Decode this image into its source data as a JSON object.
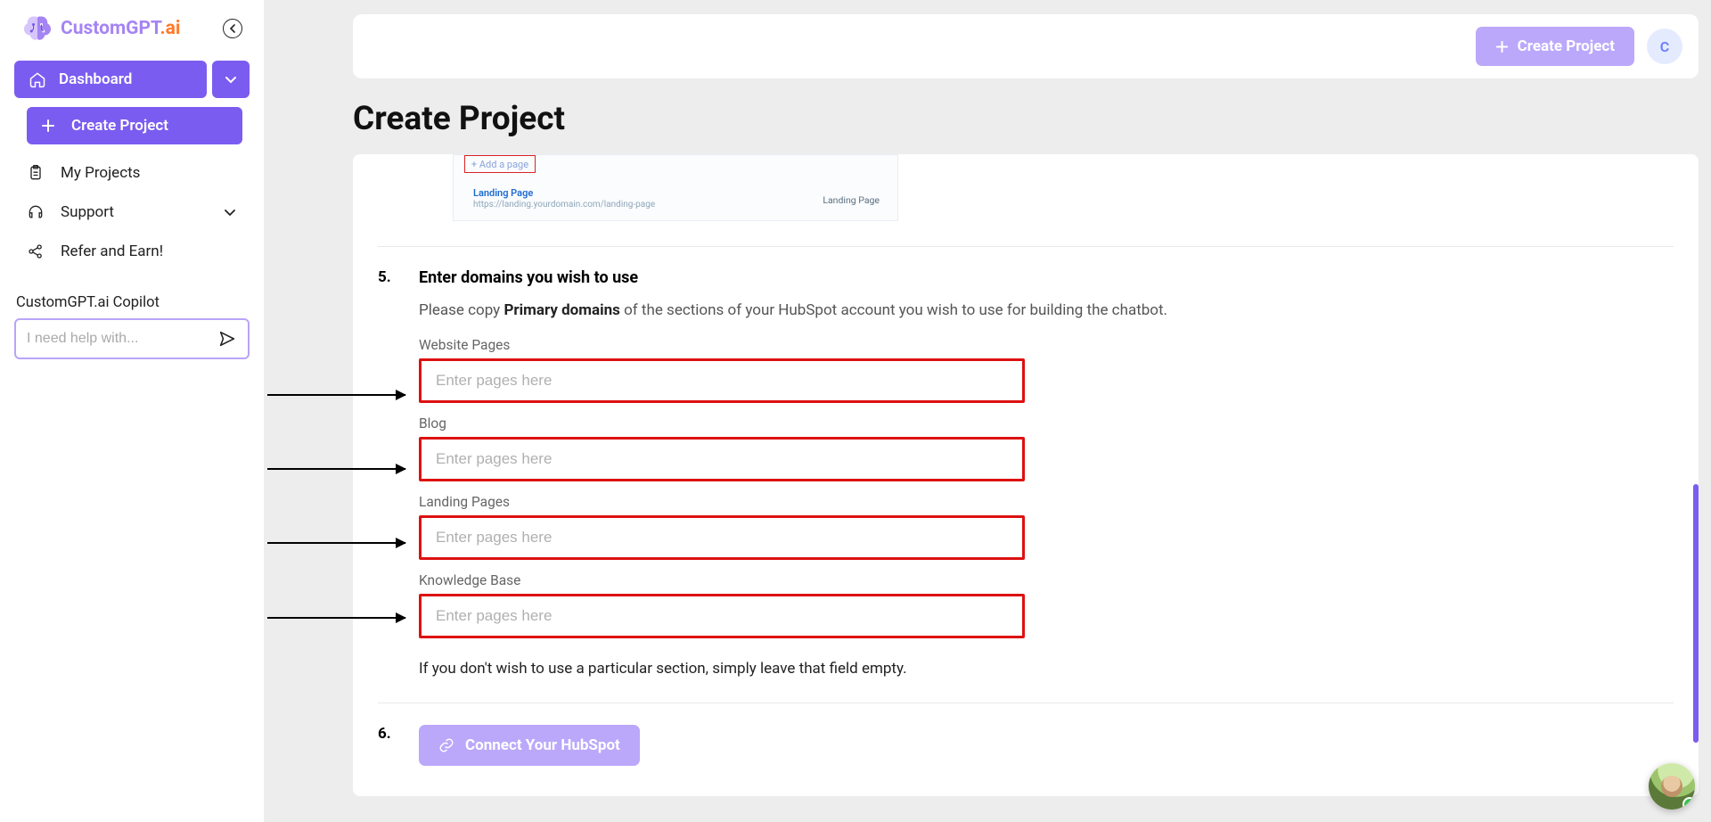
{
  "brand": {
    "name": "CustomGPT",
    "suffix": ".ai"
  },
  "sidebar": {
    "dashboard": "Dashboard",
    "create_project": "Create Project",
    "items": [
      {
        "label": "My Projects"
      },
      {
        "label": "Support"
      },
      {
        "label": "Refer and Earn!"
      }
    ],
    "copilot_label": "CustomGPT.ai Copilot",
    "copilot_placeholder": "I need help with..."
  },
  "topbar": {
    "create": "Create Project",
    "avatar_initial": "C"
  },
  "page": {
    "title": "Create Project"
  },
  "demo": {
    "add_page": "+ Add a page",
    "lp_title": "Landing Page",
    "lp_url": "https://landing.yourdomain.com/landing-page",
    "lp_right": "Landing Page"
  },
  "step5": {
    "num": "5.",
    "title": "Enter domains you wish to use",
    "desc_pre": "Please copy ",
    "desc_bold": "Primary domains",
    "desc_post": " of the sections of your HubSpot account you wish to use for building the chatbot.",
    "fields": [
      {
        "label": "Website Pages",
        "placeholder": "Enter pages here"
      },
      {
        "label": "Blog",
        "placeholder": "Enter pages here"
      },
      {
        "label": "Landing Pages",
        "placeholder": "Enter pages here"
      },
      {
        "label": "Knowledge Base",
        "placeholder": "Enter pages here"
      }
    ],
    "note": "If you don't wish to use a particular section, simply leave that field empty."
  },
  "step6": {
    "num": "6.",
    "connect": "Connect Your HubSpot"
  }
}
